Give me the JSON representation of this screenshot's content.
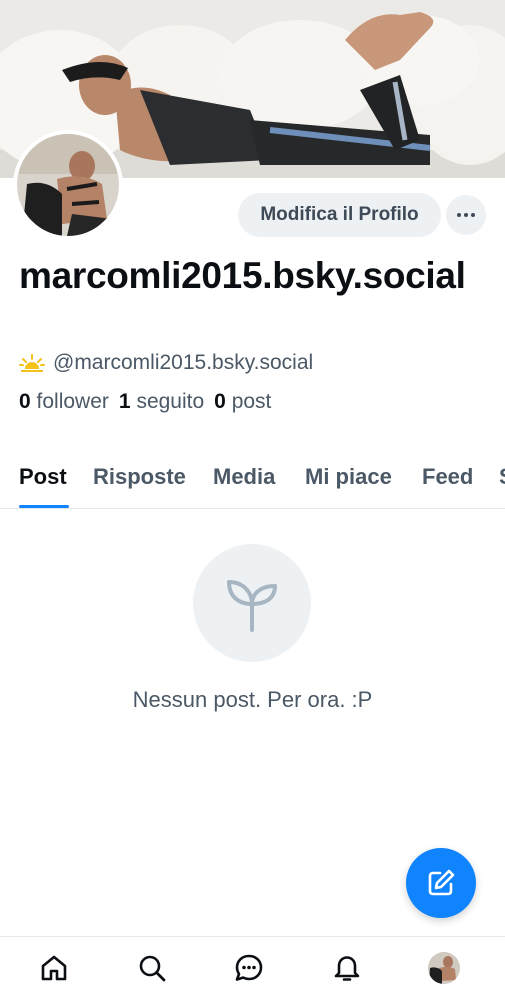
{
  "profile": {
    "display_name": "marcomli2015.bsky.social",
    "handle": "@marcomli2015.bsky.social",
    "edit_button_label": "Modifica il Profilo",
    "more_button_label": "···",
    "stats": {
      "followers_count": "0",
      "followers_label": "follower",
      "following_count": "1",
      "following_label": "seguito",
      "posts_count": "0",
      "posts_label": "post"
    }
  },
  "tabs": [
    {
      "label": "Post",
      "active": true
    },
    {
      "label": "Risposte",
      "active": false
    },
    {
      "label": "Media",
      "active": false
    },
    {
      "label": "Mi piace",
      "active": false
    },
    {
      "label": "Feed",
      "active": false
    },
    {
      "label": "S",
      "active": false
    }
  ],
  "empty_state": {
    "icon": "sprout-icon",
    "message": "Nessun post. Per ora. :P"
  },
  "fab": {
    "icon": "compose-icon"
  },
  "bottom_nav": [
    {
      "icon": "home-icon"
    },
    {
      "icon": "search-icon"
    },
    {
      "icon": "chat-icon"
    },
    {
      "icon": "bell-icon"
    },
    {
      "icon": "profile-avatar"
    }
  ],
  "colors": {
    "accent": "#1083fe",
    "text_primary": "#0b0f14",
    "text_secondary": "#4b5866",
    "button_bg": "#eef1f4"
  }
}
